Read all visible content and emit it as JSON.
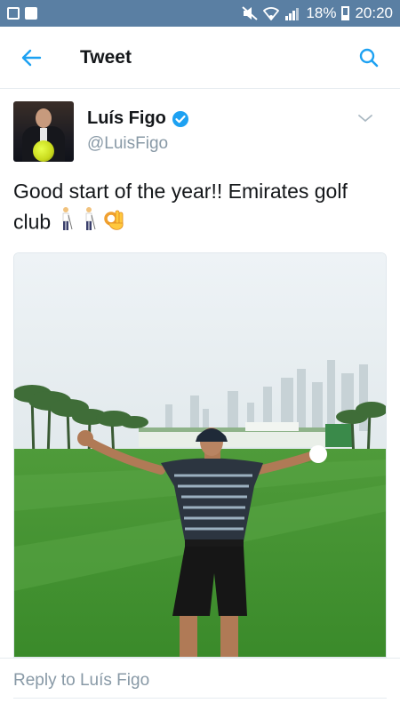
{
  "status_bar": {
    "battery": "18%",
    "time": "20:20",
    "icons": [
      "gallery-icon",
      "flipboard-icon",
      "mute-icon",
      "wifi-icon",
      "signal-icon",
      "battery-icon"
    ]
  },
  "header": {
    "title": "Tweet",
    "back_icon": "back-arrow-icon",
    "search_icon": "search-icon"
  },
  "tweet": {
    "author": {
      "name": "Luís Figo",
      "handle": "@LuisFigo",
      "verified": true
    },
    "text": "Good start of the year!! Emirates golf club",
    "emojis": [
      "golfer-emoji",
      "golfer-emoji",
      "ok-hand-emoji"
    ],
    "media": {
      "type": "photo"
    }
  },
  "reply": {
    "placeholder": "Reply to Luís Figo"
  },
  "colors": {
    "status_bar": "#5a7fa3",
    "accent": "#1da1f2",
    "secondary_text": "#8899a6",
    "border": "#e6ecf0"
  }
}
